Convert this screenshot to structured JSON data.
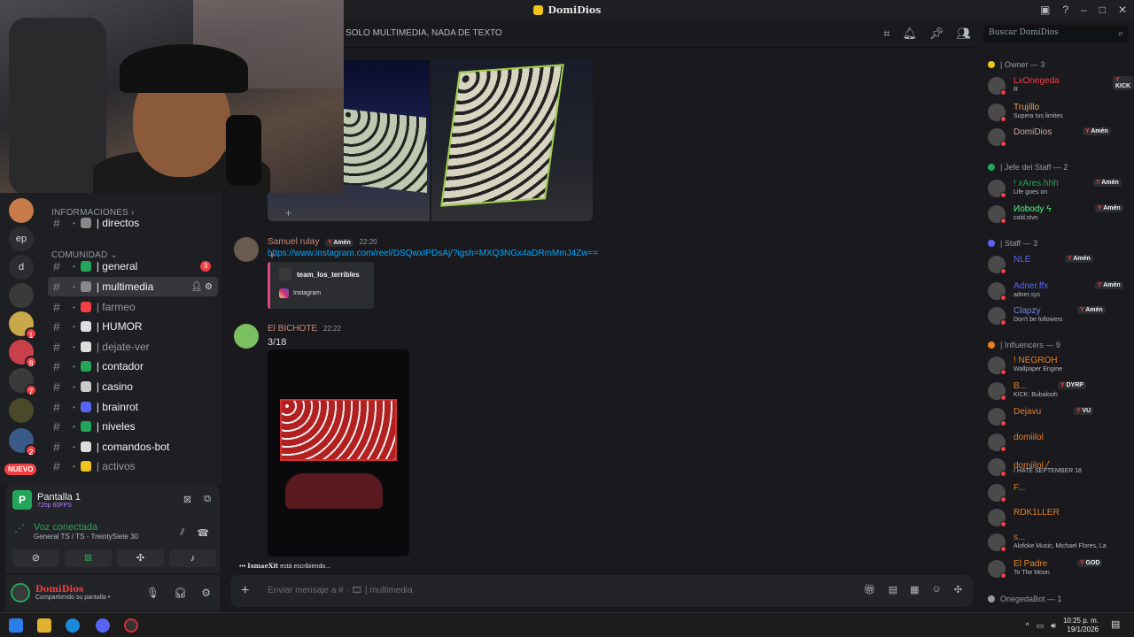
{
  "titlebar": {
    "title": "DomiDios"
  },
  "channel_header": {
    "topic": "SOLO MULTIMEDIA, NADA DE TEXTO",
    "search_placeholder": "Buscar DomiDios"
  },
  "servers": {
    "items": [
      {
        "name": "server-1",
        "color": "#c77b4a"
      },
      {
        "name": "ep",
        "label": "ep",
        "color": "#2b2d31"
      },
      {
        "name": "d-server",
        "label": "d",
        "color": "#2b2d31"
      },
      {
        "name": "clutch",
        "color": "#3a3a3a"
      },
      {
        "name": "server-5",
        "color": "#c9a84a",
        "badge": "1"
      },
      {
        "name": "server-6",
        "color": "#c9404a",
        "badge": "8"
      },
      {
        "name": "server-7",
        "color": "#3a3a3a",
        "badge": "7"
      },
      {
        "name": "server-8",
        "color": "#4a4a2a"
      },
      {
        "name": "server-9",
        "color": "#3a5a8a",
        "badge": "2"
      }
    ],
    "new_label": "NUEVO"
  },
  "sidebar": {
    "cat_info": "INFORMACIONES",
    "cat_comunidad": "COMUNIDAD",
    "channels": [
      {
        "label": "| directos",
        "emoji_color": "#888888",
        "unread": true
      },
      {
        "label": "| general",
        "emoji_color": "#23a55a",
        "unread": true,
        "badge": "3"
      },
      {
        "label": "| multimedia",
        "emoji_color": "#888888",
        "active": true
      },
      {
        "label": "| farmeo",
        "emoji_color": "#f23f43"
      },
      {
        "label": "| HUMOR",
        "emoji_color": "#dddddd",
        "unread": true
      },
      {
        "label": "| dejate-ver",
        "emoji_color": "#dddddd"
      },
      {
        "label": "| contador",
        "emoji_color": "#23a55a",
        "unread": true
      },
      {
        "label": "| casino",
        "emoji_color": "#cccccc",
        "unread": true
      },
      {
        "label": "| brainrot",
        "emoji_color": "#5865f2",
        "unread": true
      },
      {
        "label": "| niveles",
        "emoji_color": "#23a55a",
        "unread": true
      },
      {
        "label": "| comandos-bot",
        "emoji_color": "#dddddd",
        "unread": true
      },
      {
        "label": "| activos",
        "emoji_color": "#f0c419"
      }
    ]
  },
  "voice": {
    "screen_title": "Pantalla 1",
    "screen_quality": "720p 60FPS",
    "status": "Voz conectada",
    "channel": "General TS / TS - TreintySiete 30"
  },
  "user": {
    "name": "DomiDios",
    "status": "Compartiendo su pantalla •"
  },
  "messages": [
    {
      "author": "Samuel rulay",
      "role": "Amén",
      "time": "22:20",
      "link": "https://www.instagram.com/reel/DSQwxIPDsAj/?igsh=MXQ3NGx4aDRmMmJ4Zw==",
      "embed_title": "team_los_terribles",
      "embed_provider": "Instagram"
    },
    {
      "author": "El BICHOTE",
      "time": "22:22",
      "text": "3/18"
    }
  ],
  "typing": {
    "user": "IsmaeXit",
    "text": " está escribiendo..."
  },
  "composer": {
    "placeholder": "Enviar mensaje a # · 🎞 | multimedia"
  },
  "members": {
    "groups": [
      {
        "title": "| Owner — 3",
        "color": "#f0c419"
      },
      {
        "title": "| Jefe del Staff — 2",
        "color": "#23a55a"
      },
      {
        "title": "| Staff — 3",
        "color": "#5865f2"
      },
      {
        "title": "| Influencers — 9",
        "color": "#e67e22"
      },
      {
        "title": "OnegedaBot — 1",
        "color": "#949ba4"
      }
    ],
    "list": [
      {
        "name": "LxOnegeda",
        "color": "#f23f43",
        "tag": "KICK",
        "sub": "R"
      },
      {
        "name": "Trujillo",
        "color": "#f0a050",
        "sub": "Supera tus limites"
      },
      {
        "name": "DomiDios",
        "color": "#c9a8a8",
        "tag": "Amén"
      },
      {
        "name": "! xAres.hhh",
        "color": "#23a55a",
        "tag": "Amén",
        "sub": "Life goes on"
      },
      {
        "name": "Иobody ϟ",
        "color": "#57f287",
        "tag": "Amén",
        "sub": "cold.stvn"
      },
      {
        "name": "NLE",
        "color": "#5865f2",
        "tag": "Amén"
      },
      {
        "name": "Adner.ffx",
        "color": "#5865f2",
        "tag": "Amén",
        "sub": "adner.sys"
      },
      {
        "name": "Clapzy",
        "color": "#7289da",
        "tag": "Amén",
        "sub": "Don't be followers"
      },
      {
        "name": "! NEGROH",
        "color": "#e67e22",
        "sub": "Wallpaper Engine"
      },
      {
        "name": "B...",
        "color": "#e67e22",
        "tag": "DYRP",
        "sub": "KICK: Bubalooh"
      },
      {
        "name": "Dejavu",
        "color": "#e67e22",
        "tag": "VU"
      },
      {
        "name": "domiilol",
        "color": "#e67e22"
      },
      {
        "name": "domiilol〳",
        "color": "#e67e22",
        "sub": "I HATE SEPTEMBER 18"
      },
      {
        "name": "F...",
        "color": "#e67e22"
      },
      {
        "name": "RDK1LLER",
        "color": "#e67e22"
      },
      {
        "name": "s...",
        "color": "#e67e22",
        "sub": "Alofoke Music, Michael Flores, La"
      },
      {
        "name": "El Padre",
        "color": "#e67e22",
        "tag": "GOD",
        "sub": "To The Moon"
      }
    ]
  },
  "taskbar": {
    "time": "10:25 p. m.",
    "date": "19/1/2026"
  }
}
